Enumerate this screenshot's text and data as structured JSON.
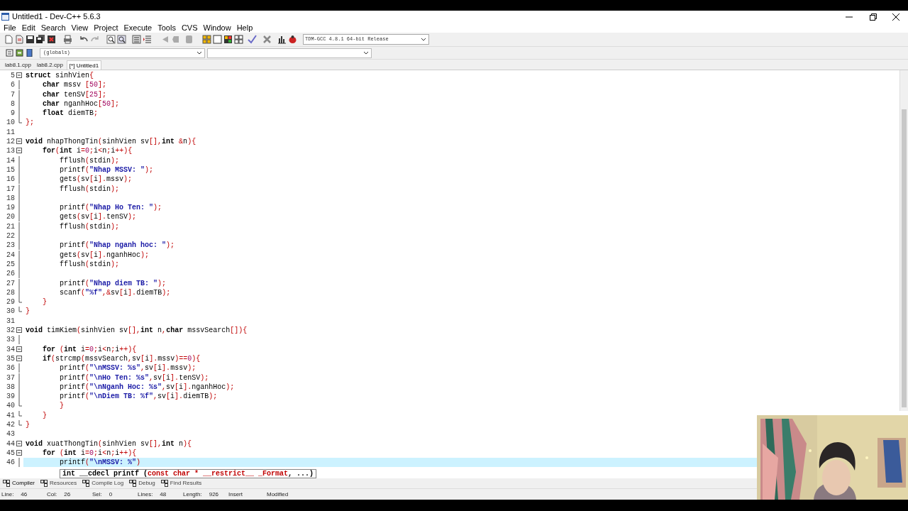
{
  "window": {
    "title": "Untitled1 - Dev-C++ 5.6.3"
  },
  "menu": [
    "File",
    "Edit",
    "Search",
    "View",
    "Project",
    "Execute",
    "Tools",
    "CVS",
    "Window",
    "Help"
  ],
  "compiler_select": {
    "value": "TDM-GCC 4.8.1 64-bit Release"
  },
  "scope_select": {
    "value": "(globals)"
  },
  "tabs": [
    {
      "label": "lab8.1.cpp",
      "selected": false
    },
    {
      "label": "lab8.2.cpp",
      "selected": false
    },
    {
      "label": "[*] Untitled1",
      "selected": true
    }
  ],
  "lines": [
    {
      "n": "5",
      "kind": "fold-start",
      "current": false,
      "code": [
        {
          "kind": "keyword",
          "text": "struct"
        },
        {
          "kind": "plain",
          "text": " sinhVien"
        },
        {
          "kind": "symbol",
          "text": "{"
        }
      ]
    },
    {
      "n": "6",
      "kind": "fold-body",
      "current": false,
      "code": [
        {
          "kind": "keyword",
          "text": "    char"
        },
        {
          "kind": "plain",
          "text": " mssv "
        },
        {
          "kind": "symbol",
          "text": "["
        },
        {
          "kind": "number",
          "text": "50"
        },
        {
          "kind": "symbol",
          "text": "];"
        }
      ]
    },
    {
      "n": "7",
      "kind": "fold-body",
      "current": false,
      "code": [
        {
          "kind": "keyword",
          "text": "    char"
        },
        {
          "kind": "plain",
          "text": " tenSV"
        },
        {
          "kind": "symbol",
          "text": "["
        },
        {
          "kind": "number",
          "text": "25"
        },
        {
          "kind": "symbol",
          "text": "];"
        }
      ]
    },
    {
      "n": "8",
      "kind": "fold-body",
      "current": false,
      "code": [
        {
          "kind": "keyword",
          "text": "    char"
        },
        {
          "kind": "plain",
          "text": " nganhHoc"
        },
        {
          "kind": "symbol",
          "text": "["
        },
        {
          "kind": "number",
          "text": "50"
        },
        {
          "kind": "symbol",
          "text": "];"
        }
      ]
    },
    {
      "n": "9",
      "kind": "fold-body",
      "current": false,
      "code": [
        {
          "kind": "keyword",
          "text": "    float"
        },
        {
          "kind": "plain",
          "text": " diemTB"
        },
        {
          "kind": "symbol",
          "text": ";"
        }
      ]
    },
    {
      "n": "10",
      "kind": "fold-end",
      "current": false,
      "code": [
        {
          "kind": "symbol",
          "text": "};"
        }
      ]
    },
    {
      "n": "11",
      "kind": "plain",
      "current": false
    },
    {
      "n": "12",
      "kind": "fold-start",
      "current": false,
      "code": [
        {
          "kind": "keyword",
          "text": "void"
        },
        {
          "kind": "plain",
          "text": " nhapThongTin"
        },
        {
          "kind": "symbol",
          "text": "("
        },
        {
          "kind": "plain",
          "text": "sinhVien sv"
        },
        {
          "kind": "symbol",
          "text": "[],"
        },
        {
          "kind": "keyword",
          "text": "int "
        },
        {
          "kind": "symbol",
          "text": "&"
        },
        {
          "kind": "plain",
          "text": "n"
        },
        {
          "kind": "symbol",
          "text": "){"
        }
      ]
    },
    {
      "n": "13",
      "kind": "fold-start",
      "current": false,
      "code": [
        {
          "kind": "keyword",
          "text": "    for"
        },
        {
          "kind": "symbol",
          "text": "("
        },
        {
          "kind": "keyword",
          "text": "int"
        },
        {
          "kind": "plain",
          "text": " i"
        },
        {
          "kind": "symbol",
          "text": "="
        },
        {
          "kind": "number",
          "text": "0"
        },
        {
          "kind": "symbol",
          "text": ";"
        },
        {
          "kind": "plain",
          "text": "i"
        },
        {
          "kind": "symbol",
          "text": "<"
        },
        {
          "kind": "plain",
          "text": "n"
        },
        {
          "kind": "symbol",
          "text": ";"
        },
        {
          "kind": "plain",
          "text": "i"
        },
        {
          "kind": "symbol",
          "text": "++){"
        }
      ]
    },
    {
      "n": "14",
      "kind": "fold-body",
      "current": false,
      "code": [
        {
          "kind": "plain",
          "text": "        fflush"
        },
        {
          "kind": "symbol",
          "text": "("
        },
        {
          "kind": "plain",
          "text": "stdin"
        },
        {
          "kind": "symbol",
          "text": ");"
        }
      ]
    },
    {
      "n": "15",
      "kind": "fold-body",
      "current": false,
      "code": [
        {
          "kind": "plain",
          "text": "        printf"
        },
        {
          "kind": "symbol",
          "text": "("
        },
        {
          "kind": "string",
          "text": "\"Nhap MSSV: \""
        },
        {
          "kind": "symbol",
          "text": ");"
        }
      ]
    },
    {
      "n": "16",
      "kind": "fold-body",
      "current": false,
      "code": [
        {
          "kind": "plain",
          "text": "        gets"
        },
        {
          "kind": "symbol",
          "text": "("
        },
        {
          "kind": "plain",
          "text": "sv"
        },
        {
          "kind": "symbol",
          "text": "["
        },
        {
          "kind": "plain",
          "text": "i"
        },
        {
          "kind": "symbol",
          "text": "]."
        },
        {
          "kind": "plain",
          "text": "mssv"
        },
        {
          "kind": "symbol",
          "text": ");"
        }
      ]
    },
    {
      "n": "17",
      "kind": "fold-body",
      "current": false,
      "code": [
        {
          "kind": "plain",
          "text": "        fflush"
        },
        {
          "kind": "symbol",
          "text": "("
        },
        {
          "kind": "plain",
          "text": "stdin"
        },
        {
          "kind": "symbol",
          "text": ");"
        }
      ]
    },
    {
      "n": "18",
      "kind": "fold-body",
      "current": false
    },
    {
      "n": "19",
      "kind": "fold-body",
      "current": false,
      "code": [
        {
          "kind": "plain",
          "text": "        printf"
        },
        {
          "kind": "symbol",
          "text": "("
        },
        {
          "kind": "string",
          "text": "\"Nhap Ho Ten: \""
        },
        {
          "kind": "symbol",
          "text": ");"
        }
      ]
    },
    {
      "n": "20",
      "kind": "fold-body",
      "current": false,
      "code": [
        {
          "kind": "plain",
          "text": "        gets"
        },
        {
          "kind": "symbol",
          "text": "("
        },
        {
          "kind": "plain",
          "text": "sv"
        },
        {
          "kind": "symbol",
          "text": "["
        },
        {
          "kind": "plain",
          "text": "i"
        },
        {
          "kind": "symbol",
          "text": "]."
        },
        {
          "kind": "plain",
          "text": "tenSV"
        },
        {
          "kind": "symbol",
          "text": ");"
        }
      ]
    },
    {
      "n": "21",
      "kind": "fold-body",
      "current": false,
      "code": [
        {
          "kind": "plain",
          "text": "        fflush"
        },
        {
          "kind": "symbol",
          "text": "("
        },
        {
          "kind": "plain",
          "text": "stdin"
        },
        {
          "kind": "symbol",
          "text": ");"
        }
      ]
    },
    {
      "n": "22",
      "kind": "fold-body",
      "current": false
    },
    {
      "n": "23",
      "kind": "fold-body",
      "current": false,
      "code": [
        {
          "kind": "plain",
          "text": "        printf"
        },
        {
          "kind": "symbol",
          "text": "("
        },
        {
          "kind": "string",
          "text": "\"Nhap nganh hoc: \""
        },
        {
          "kind": "symbol",
          "text": ");"
        }
      ]
    },
    {
      "n": "24",
      "kind": "fold-body",
      "current": false,
      "code": [
        {
          "kind": "plain",
          "text": "        gets"
        },
        {
          "kind": "symbol",
          "text": "("
        },
        {
          "kind": "plain",
          "text": "sv"
        },
        {
          "kind": "symbol",
          "text": "["
        },
        {
          "kind": "plain",
          "text": "i"
        },
        {
          "kind": "symbol",
          "text": "]."
        },
        {
          "kind": "plain",
          "text": "nganhHoc"
        },
        {
          "kind": "symbol",
          "text": ");"
        }
      ]
    },
    {
      "n": "25",
      "kind": "fold-body",
      "current": false,
      "code": [
        {
          "kind": "plain",
          "text": "        fflush"
        },
        {
          "kind": "symbol",
          "text": "("
        },
        {
          "kind": "plain",
          "text": "stdin"
        },
        {
          "kind": "symbol",
          "text": ");"
        }
      ]
    },
    {
      "n": "26",
      "kind": "fold-body",
      "current": false
    },
    {
      "n": "27",
      "kind": "fold-body",
      "current": false,
      "code": [
        {
          "kind": "plain",
          "text": "        printf"
        },
        {
          "kind": "symbol",
          "text": "("
        },
        {
          "kind": "string",
          "text": "\"Nhap diem TB: \""
        },
        {
          "kind": "symbol",
          "text": ");"
        }
      ]
    },
    {
      "n": "28",
      "kind": "fold-body",
      "current": false,
      "code": [
        {
          "kind": "plain",
          "text": "        scanf"
        },
        {
          "kind": "symbol",
          "text": "("
        },
        {
          "kind": "string",
          "text": "\"%f\""
        },
        {
          "kind": "symbol",
          "text": ",&"
        },
        {
          "kind": "plain",
          "text": "sv"
        },
        {
          "kind": "symbol",
          "text": "["
        },
        {
          "kind": "plain",
          "text": "i"
        },
        {
          "kind": "symbol",
          "text": "]."
        },
        {
          "kind": "plain",
          "text": "diemTB"
        },
        {
          "kind": "symbol",
          "text": ");"
        }
      ]
    },
    {
      "n": "29",
      "kind": "fold-end",
      "current": false,
      "code": [
        {
          "kind": "symbol",
          "text": "    }"
        }
      ]
    },
    {
      "n": "30",
      "kind": "fold-end",
      "current": false,
      "code": [
        {
          "kind": "symbol",
          "text": "}"
        }
      ]
    },
    {
      "n": "31",
      "kind": "plain",
      "current": false
    },
    {
      "n": "32",
      "kind": "fold-start",
      "current": false,
      "code": [
        {
          "kind": "keyword",
          "text": "void"
        },
        {
          "kind": "plain",
          "text": " timKiem"
        },
        {
          "kind": "symbol",
          "text": "("
        },
        {
          "kind": "plain",
          "text": "sinhVien sv"
        },
        {
          "kind": "symbol",
          "text": "[],"
        },
        {
          "kind": "keyword",
          "text": "int"
        },
        {
          "kind": "plain",
          "text": " n"
        },
        {
          "kind": "symbol",
          "text": ","
        },
        {
          "kind": "keyword",
          "text": "char"
        },
        {
          "kind": "plain",
          "text": " mssvSearch"
        },
        {
          "kind": "symbol",
          "text": "[]){"
        }
      ]
    },
    {
      "n": "33",
      "kind": "fold-body",
      "current": false
    },
    {
      "n": "34",
      "kind": "fold-start",
      "current": false,
      "code": [
        {
          "kind": "keyword",
          "text": "    for "
        },
        {
          "kind": "symbol",
          "text": "("
        },
        {
          "kind": "keyword",
          "text": "int"
        },
        {
          "kind": "plain",
          "text": " i"
        },
        {
          "kind": "symbol",
          "text": "="
        },
        {
          "kind": "number",
          "text": "0"
        },
        {
          "kind": "symbol",
          "text": ";"
        },
        {
          "kind": "plain",
          "text": "i"
        },
        {
          "kind": "symbol",
          "text": "<"
        },
        {
          "kind": "plain",
          "text": "n"
        },
        {
          "kind": "symbol",
          "text": ";"
        },
        {
          "kind": "plain",
          "text": "i"
        },
        {
          "kind": "symbol",
          "text": "++){"
        }
      ]
    },
    {
      "n": "35",
      "kind": "fold-start",
      "current": false,
      "code": [
        {
          "kind": "keyword",
          "text": "    if"
        },
        {
          "kind": "symbol",
          "text": "("
        },
        {
          "kind": "plain",
          "text": "strcmp"
        },
        {
          "kind": "symbol",
          "text": "("
        },
        {
          "kind": "plain",
          "text": "mssvSearch"
        },
        {
          "kind": "symbol",
          "text": ","
        },
        {
          "kind": "plain",
          "text": "sv"
        },
        {
          "kind": "symbol",
          "text": "["
        },
        {
          "kind": "plain",
          "text": "i"
        },
        {
          "kind": "symbol",
          "text": "]."
        },
        {
          "kind": "plain",
          "text": "mssv"
        },
        {
          "kind": "symbol",
          "text": ")=="
        },
        {
          "kind": "number",
          "text": "0"
        },
        {
          "kind": "symbol",
          "text": "){"
        }
      ]
    },
    {
      "n": "36",
      "kind": "fold-body",
      "current": false,
      "code": [
        {
          "kind": "plain",
          "text": "        printf"
        },
        {
          "kind": "symbol",
          "text": "("
        },
        {
          "kind": "string",
          "text": "\"\\nMSSV: %s\""
        },
        {
          "kind": "symbol",
          "text": ","
        },
        {
          "kind": "plain",
          "text": "sv"
        },
        {
          "kind": "symbol",
          "text": "["
        },
        {
          "kind": "plain",
          "text": "i"
        },
        {
          "kind": "symbol",
          "text": "]."
        },
        {
          "kind": "plain",
          "text": "mssv"
        },
        {
          "kind": "symbol",
          "text": ");"
        }
      ]
    },
    {
      "n": "37",
      "kind": "fold-body",
      "current": false,
      "code": [
        {
          "kind": "plain",
          "text": "        printf"
        },
        {
          "kind": "symbol",
          "text": "("
        },
        {
          "kind": "string",
          "text": "\"\\nHo Ten: %s\""
        },
        {
          "kind": "symbol",
          "text": ","
        },
        {
          "kind": "plain",
          "text": "sv"
        },
        {
          "kind": "symbol",
          "text": "["
        },
        {
          "kind": "plain",
          "text": "i"
        },
        {
          "kind": "symbol",
          "text": "]."
        },
        {
          "kind": "plain",
          "text": "tenSV"
        },
        {
          "kind": "symbol",
          "text": ");"
        }
      ]
    },
    {
      "n": "38",
      "kind": "fold-body",
      "current": false,
      "code": [
        {
          "kind": "plain",
          "text": "        printf"
        },
        {
          "kind": "symbol",
          "text": "("
        },
        {
          "kind": "string",
          "text": "\"\\nNganh Hoc: %s\""
        },
        {
          "kind": "symbol",
          "text": ","
        },
        {
          "kind": "plain",
          "text": "sv"
        },
        {
          "kind": "symbol",
          "text": "["
        },
        {
          "kind": "plain",
          "text": "i"
        },
        {
          "kind": "symbol",
          "text": "]."
        },
        {
          "kind": "plain",
          "text": "nganhHoc"
        },
        {
          "kind": "symbol",
          "text": ");"
        }
      ]
    },
    {
      "n": "39",
      "kind": "fold-body",
      "current": false,
      "code": [
        {
          "kind": "plain",
          "text": "        printf"
        },
        {
          "kind": "symbol",
          "text": "("
        },
        {
          "kind": "string",
          "text": "\"\\nDiem TB: %f\""
        },
        {
          "kind": "symbol",
          "text": ","
        },
        {
          "kind": "plain",
          "text": "sv"
        },
        {
          "kind": "symbol",
          "text": "["
        },
        {
          "kind": "plain",
          "text": "i"
        },
        {
          "kind": "symbol",
          "text": "]."
        },
        {
          "kind": "plain",
          "text": "diemTB"
        },
        {
          "kind": "symbol",
          "text": ");"
        }
      ]
    },
    {
      "n": "40",
      "kind": "fold-end",
      "current": false,
      "code": [
        {
          "kind": "symbol",
          "text": "        }"
        }
      ]
    },
    {
      "n": "41",
      "kind": "fold-end",
      "current": false,
      "code": [
        {
          "kind": "symbol",
          "text": "    }"
        }
      ]
    },
    {
      "n": "42",
      "kind": "fold-end",
      "current": false,
      "code": [
        {
          "kind": "symbol",
          "text": "}"
        }
      ]
    },
    {
      "n": "43",
      "kind": "plain",
      "current": false
    },
    {
      "n": "44",
      "kind": "fold-start",
      "current": false,
      "code": [
        {
          "kind": "keyword",
          "text": "void"
        },
        {
          "kind": "plain",
          "text": " xuatThongTin"
        },
        {
          "kind": "symbol",
          "text": "("
        },
        {
          "kind": "plain",
          "text": "sinhVien sv"
        },
        {
          "kind": "symbol",
          "text": "[],"
        },
        {
          "kind": "keyword",
          "text": "int"
        },
        {
          "kind": "plain",
          "text": " n"
        },
        {
          "kind": "symbol",
          "text": "){"
        }
      ]
    },
    {
      "n": "45",
      "kind": "fold-start",
      "current": false,
      "code": [
        {
          "kind": "keyword",
          "text": "    for "
        },
        {
          "kind": "symbol",
          "text": "("
        },
        {
          "kind": "keyword",
          "text": "int"
        },
        {
          "kind": "plain",
          "text": " i"
        },
        {
          "kind": "symbol",
          "text": "="
        },
        {
          "kind": "number",
          "text": "0"
        },
        {
          "kind": "symbol",
          "text": ";"
        },
        {
          "kind": "plain",
          "text": "i"
        },
        {
          "kind": "symbol",
          "text": "<"
        },
        {
          "kind": "plain",
          "text": "n"
        },
        {
          "kind": "symbol",
          "text": ";"
        },
        {
          "kind": "plain",
          "text": "i"
        },
        {
          "kind": "symbol",
          "text": "++){"
        }
      ]
    },
    {
      "n": "46",
      "kind": "fold-body",
      "current": true,
      "code": [
        {
          "kind": "plain",
          "text": "        printf"
        },
        {
          "kind": "symbol",
          "text": "("
        },
        {
          "kind": "string",
          "text": "\"\\nMSSV: %\""
        },
        {
          "kind": "symbol",
          "text": ")"
        }
      ]
    }
  ],
  "tooltip": [
    {
      "kind": "plain",
      "text": "int __cdecl printf ("
    },
    {
      "kind": "param",
      "text": "const char * __restrict__ _Format"
    },
    {
      "kind": "plain",
      "text": ", ...)"
    }
  ],
  "bottom_tabs": [
    {
      "label": "Compiler",
      "selected": true
    },
    {
      "label": "Resources",
      "selected": false
    },
    {
      "label": "Compile Log",
      "selected": false
    },
    {
      "label": "Debug",
      "selected": false
    },
    {
      "label": "Find Results",
      "selected": false
    }
  ],
  "status_bar": [
    {
      "label": "Line:",
      "value": "46"
    },
    {
      "label": "Col:",
      "value": "26"
    },
    {
      "label": "Sel:",
      "value": "0"
    },
    {
      "label": "Lines:",
      "value": "48"
    },
    {
      "label": "Length:",
      "value": "926"
    }
  ],
  "status_flags": [
    "Insert",
    "Modified"
  ]
}
